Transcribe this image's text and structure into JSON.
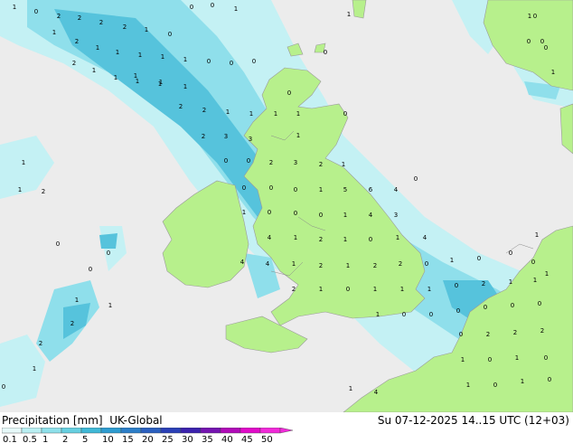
{
  "title": {
    "product": "Precipitation [mm]",
    "model": "UK-Global"
  },
  "valid_time": "Su 07-12-2025 14..15 UTC (12+03)",
  "legend": {
    "tick_labels": [
      "0.1",
      "0.5",
      "1",
      "2",
      "5",
      "10",
      "15",
      "20",
      "25",
      "30",
      "35",
      "40",
      "45",
      "50"
    ],
    "colors": [
      "#e6f9f9",
      "#b9eff2",
      "#8ee0ea",
      "#66cfe0",
      "#40b8d6",
      "#2e9cd0",
      "#2c7ec8",
      "#2b5fbf",
      "#2a3fb6",
      "#3b22ad",
      "#7414b0",
      "#b00ab8",
      "#e00ac8",
      "#f02ad8"
    ]
  },
  "colors": {
    "sea": "#ececec",
    "land": "#b7f08c",
    "precip_light": "#c4f1f4",
    "precip_moderate": "#8fdfeb",
    "precip_heavy": "#56c3dc",
    "label": "#000000"
  },
  "map_labels": [
    "1",
    "0",
    "2",
    "2",
    "2",
    "2",
    "1",
    "0",
    "0",
    "0",
    "1",
    "2",
    "1",
    "1",
    "1",
    "1",
    "1",
    "1",
    "2",
    "1",
    "1",
    "1",
    "1",
    "1",
    "0",
    "0",
    "0",
    "1",
    "1",
    "2",
    "2",
    "1",
    "2",
    "3",
    "3",
    "1",
    "1",
    "1",
    "0",
    "0",
    "0",
    "2",
    "3",
    "2",
    "1",
    "0",
    "0",
    "0",
    "1",
    "5",
    "6",
    "4",
    "1",
    "0",
    "0",
    "0",
    "1",
    "4",
    "3",
    "4",
    "1",
    "2",
    "1",
    "0",
    "1",
    "4",
    "4",
    "4",
    "1",
    "2",
    "1",
    "2",
    "2",
    "0",
    "1",
    "0",
    "2",
    "1",
    "0",
    "1",
    "1",
    "1",
    "0",
    "2",
    "1",
    "1",
    "1",
    "0",
    "0",
    "0",
    "0",
    "0",
    "0",
    "0",
    "2",
    "2",
    "2",
    "1",
    "0",
    "1",
    "0",
    "1",
    "0",
    "1",
    "0",
    "1",
    "4",
    "0",
    "0",
    "1",
    "2",
    "2",
    "1",
    "1",
    "2",
    "1",
    "0",
    "1",
    "0",
    "1",
    "0",
    "1",
    "1",
    "0",
    "0",
    "0",
    "1",
    "1",
    "0",
    "0",
    "0",
    "0",
    "1",
    "0"
  ]
}
